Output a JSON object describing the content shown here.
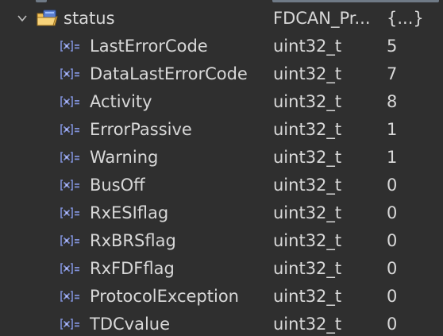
{
  "variables_view": {
    "parent": {
      "name": "status",
      "type": "FDCAN_Pr...",
      "value": "{...}",
      "icon": "struct-folder-icon",
      "expander_icon": "chevron-down-icon"
    },
    "fields": [
      {
        "name": "LastErrorCode",
        "type": "uint32_t",
        "value": "5",
        "icon": "field-icon"
      },
      {
        "name": "DataLastErrorCode",
        "type": "uint32_t",
        "value": "7",
        "icon": "field-icon"
      },
      {
        "name": "Activity",
        "type": "uint32_t",
        "value": "8",
        "icon": "field-icon"
      },
      {
        "name": "ErrorPassive",
        "type": "uint32_t",
        "value": "1",
        "icon": "field-icon"
      },
      {
        "name": "Warning",
        "type": "uint32_t",
        "value": "1",
        "icon": "field-icon"
      },
      {
        "name": "BusOff",
        "type": "uint32_t",
        "value": "0",
        "icon": "field-icon"
      },
      {
        "name": "RxESIflag",
        "type": "uint32_t",
        "value": "0",
        "icon": "field-icon"
      },
      {
        "name": "RxBRSflag",
        "type": "uint32_t",
        "value": "0",
        "icon": "field-icon"
      },
      {
        "name": "RxFDFflag",
        "type": "uint32_t",
        "value": "0",
        "icon": "field-icon"
      },
      {
        "name": "ProtocolException",
        "type": "uint32_t",
        "value": "0",
        "icon": "field-icon"
      },
      {
        "name": "TDCvalue",
        "type": "uint32_t",
        "value": "0",
        "icon": "field-icon"
      }
    ]
  },
  "colors": {
    "background": "#2f2f2f",
    "text": "#d8d8d8",
    "field_icon": "#7f8fd6"
  }
}
